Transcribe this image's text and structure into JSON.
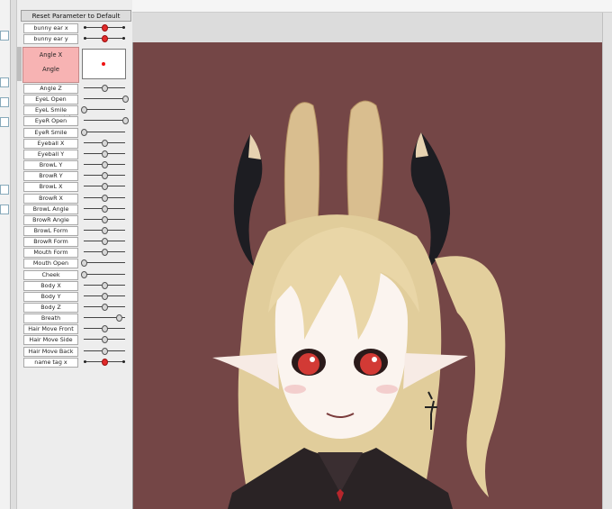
{
  "panel": {
    "reset_label": "Reset Parameter to Default",
    "angle_x_label": "Angle X",
    "angle_y_label": "Angle"
  },
  "parameters": [
    {
      "label": "bunny ear x",
      "value": 0.5,
      "active": true,
      "dots": true
    },
    {
      "label": "bunny ear y",
      "value": 0.5,
      "active": true,
      "dots": true
    },
    {
      "label": "Angle Z",
      "value": 0.5
    },
    {
      "label": "EyeL Open",
      "value": 1.0
    },
    {
      "label": "EyeL Smile",
      "value": 0.0
    },
    {
      "label": "EyeR Open",
      "value": 1.0
    },
    {
      "label": "EyeR Smile",
      "value": 0.0
    },
    {
      "label": "Eyeball X",
      "value": 0.5
    },
    {
      "label": "Eyeball Y",
      "value": 0.5
    },
    {
      "label": "BrowL Y",
      "value": 0.5
    },
    {
      "label": "BrowR Y",
      "value": 0.5
    },
    {
      "label": "BrowL X",
      "value": 0.5
    },
    {
      "label": "BrowR X",
      "value": 0.5
    },
    {
      "label": "BrowL Angle",
      "value": 0.5
    },
    {
      "label": "BrowR Angle",
      "value": 0.5
    },
    {
      "label": "BrowL Form",
      "value": 0.5
    },
    {
      "label": "BrowR Form",
      "value": 0.5
    },
    {
      "label": "Mouth Form",
      "value": 0.5
    },
    {
      "label": "Mouth Open",
      "value": 0.0
    },
    {
      "label": "Cheek",
      "value": 0.0
    },
    {
      "label": "Body X",
      "value": 0.5
    },
    {
      "label": "Body Y",
      "value": 0.5
    },
    {
      "label": "Body Z",
      "value": 0.5
    },
    {
      "label": "Breath",
      "value": 0.85
    },
    {
      "label": "Hair Move Front",
      "value": 0.5
    },
    {
      "label": "Hair Move Side",
      "value": 0.5
    },
    {
      "label": "Hair Move Back",
      "value": 0.5
    },
    {
      "label": "name tag x",
      "value": 0.5,
      "active": true,
      "dots": true
    }
  ],
  "colors": {
    "canvas_bg": "#744646",
    "active_knob": "#e12a2a",
    "angle_box": "#f7b3b3"
  }
}
